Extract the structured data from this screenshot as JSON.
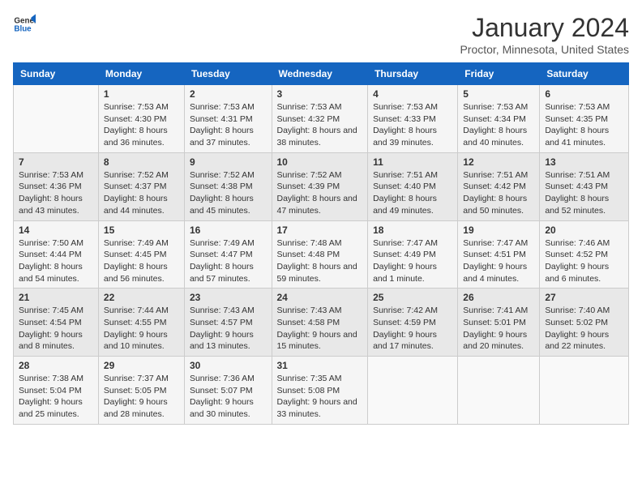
{
  "logo": {
    "line1": "General",
    "line2": "Blue"
  },
  "title": "January 2024",
  "subtitle": "Proctor, Minnesota, United States",
  "days_header": [
    "Sunday",
    "Monday",
    "Tuesday",
    "Wednesday",
    "Thursday",
    "Friday",
    "Saturday"
  ],
  "weeks": [
    [
      {
        "num": "",
        "sunrise": "",
        "sunset": "",
        "daylight": ""
      },
      {
        "num": "1",
        "sunrise": "Sunrise: 7:53 AM",
        "sunset": "Sunset: 4:30 PM",
        "daylight": "Daylight: 8 hours and 36 minutes."
      },
      {
        "num": "2",
        "sunrise": "Sunrise: 7:53 AM",
        "sunset": "Sunset: 4:31 PM",
        "daylight": "Daylight: 8 hours and 37 minutes."
      },
      {
        "num": "3",
        "sunrise": "Sunrise: 7:53 AM",
        "sunset": "Sunset: 4:32 PM",
        "daylight": "Daylight: 8 hours and 38 minutes."
      },
      {
        "num": "4",
        "sunrise": "Sunrise: 7:53 AM",
        "sunset": "Sunset: 4:33 PM",
        "daylight": "Daylight: 8 hours and 39 minutes."
      },
      {
        "num": "5",
        "sunrise": "Sunrise: 7:53 AM",
        "sunset": "Sunset: 4:34 PM",
        "daylight": "Daylight: 8 hours and 40 minutes."
      },
      {
        "num": "6",
        "sunrise": "Sunrise: 7:53 AM",
        "sunset": "Sunset: 4:35 PM",
        "daylight": "Daylight: 8 hours and 41 minutes."
      }
    ],
    [
      {
        "num": "7",
        "sunrise": "Sunrise: 7:53 AM",
        "sunset": "Sunset: 4:36 PM",
        "daylight": "Daylight: 8 hours and 43 minutes."
      },
      {
        "num": "8",
        "sunrise": "Sunrise: 7:52 AM",
        "sunset": "Sunset: 4:37 PM",
        "daylight": "Daylight: 8 hours and 44 minutes."
      },
      {
        "num": "9",
        "sunrise": "Sunrise: 7:52 AM",
        "sunset": "Sunset: 4:38 PM",
        "daylight": "Daylight: 8 hours and 45 minutes."
      },
      {
        "num": "10",
        "sunrise": "Sunrise: 7:52 AM",
        "sunset": "Sunset: 4:39 PM",
        "daylight": "Daylight: 8 hours and 47 minutes."
      },
      {
        "num": "11",
        "sunrise": "Sunrise: 7:51 AM",
        "sunset": "Sunset: 4:40 PM",
        "daylight": "Daylight: 8 hours and 49 minutes."
      },
      {
        "num": "12",
        "sunrise": "Sunrise: 7:51 AM",
        "sunset": "Sunset: 4:42 PM",
        "daylight": "Daylight: 8 hours and 50 minutes."
      },
      {
        "num": "13",
        "sunrise": "Sunrise: 7:51 AM",
        "sunset": "Sunset: 4:43 PM",
        "daylight": "Daylight: 8 hours and 52 minutes."
      }
    ],
    [
      {
        "num": "14",
        "sunrise": "Sunrise: 7:50 AM",
        "sunset": "Sunset: 4:44 PM",
        "daylight": "Daylight: 8 hours and 54 minutes."
      },
      {
        "num": "15",
        "sunrise": "Sunrise: 7:49 AM",
        "sunset": "Sunset: 4:45 PM",
        "daylight": "Daylight: 8 hours and 56 minutes."
      },
      {
        "num": "16",
        "sunrise": "Sunrise: 7:49 AM",
        "sunset": "Sunset: 4:47 PM",
        "daylight": "Daylight: 8 hours and 57 minutes."
      },
      {
        "num": "17",
        "sunrise": "Sunrise: 7:48 AM",
        "sunset": "Sunset: 4:48 PM",
        "daylight": "Daylight: 8 hours and 59 minutes."
      },
      {
        "num": "18",
        "sunrise": "Sunrise: 7:47 AM",
        "sunset": "Sunset: 4:49 PM",
        "daylight": "Daylight: 9 hours and 1 minute."
      },
      {
        "num": "19",
        "sunrise": "Sunrise: 7:47 AM",
        "sunset": "Sunset: 4:51 PM",
        "daylight": "Daylight: 9 hours and 4 minutes."
      },
      {
        "num": "20",
        "sunrise": "Sunrise: 7:46 AM",
        "sunset": "Sunset: 4:52 PM",
        "daylight": "Daylight: 9 hours and 6 minutes."
      }
    ],
    [
      {
        "num": "21",
        "sunrise": "Sunrise: 7:45 AM",
        "sunset": "Sunset: 4:54 PM",
        "daylight": "Daylight: 9 hours and 8 minutes."
      },
      {
        "num": "22",
        "sunrise": "Sunrise: 7:44 AM",
        "sunset": "Sunset: 4:55 PM",
        "daylight": "Daylight: 9 hours and 10 minutes."
      },
      {
        "num": "23",
        "sunrise": "Sunrise: 7:43 AM",
        "sunset": "Sunset: 4:57 PM",
        "daylight": "Daylight: 9 hours and 13 minutes."
      },
      {
        "num": "24",
        "sunrise": "Sunrise: 7:43 AM",
        "sunset": "Sunset: 4:58 PM",
        "daylight": "Daylight: 9 hours and 15 minutes."
      },
      {
        "num": "25",
        "sunrise": "Sunrise: 7:42 AM",
        "sunset": "Sunset: 4:59 PM",
        "daylight": "Daylight: 9 hours and 17 minutes."
      },
      {
        "num": "26",
        "sunrise": "Sunrise: 7:41 AM",
        "sunset": "Sunset: 5:01 PM",
        "daylight": "Daylight: 9 hours and 20 minutes."
      },
      {
        "num": "27",
        "sunrise": "Sunrise: 7:40 AM",
        "sunset": "Sunset: 5:02 PM",
        "daylight": "Daylight: 9 hours and 22 minutes."
      }
    ],
    [
      {
        "num": "28",
        "sunrise": "Sunrise: 7:38 AM",
        "sunset": "Sunset: 5:04 PM",
        "daylight": "Daylight: 9 hours and 25 minutes."
      },
      {
        "num": "29",
        "sunrise": "Sunrise: 7:37 AM",
        "sunset": "Sunset: 5:05 PM",
        "daylight": "Daylight: 9 hours and 28 minutes."
      },
      {
        "num": "30",
        "sunrise": "Sunrise: 7:36 AM",
        "sunset": "Sunset: 5:07 PM",
        "daylight": "Daylight: 9 hours and 30 minutes."
      },
      {
        "num": "31",
        "sunrise": "Sunrise: 7:35 AM",
        "sunset": "Sunset: 5:08 PM",
        "daylight": "Daylight: 9 hours and 33 minutes."
      },
      {
        "num": "",
        "sunrise": "",
        "sunset": "",
        "daylight": ""
      },
      {
        "num": "",
        "sunrise": "",
        "sunset": "",
        "daylight": ""
      },
      {
        "num": "",
        "sunrise": "",
        "sunset": "",
        "daylight": ""
      }
    ]
  ]
}
